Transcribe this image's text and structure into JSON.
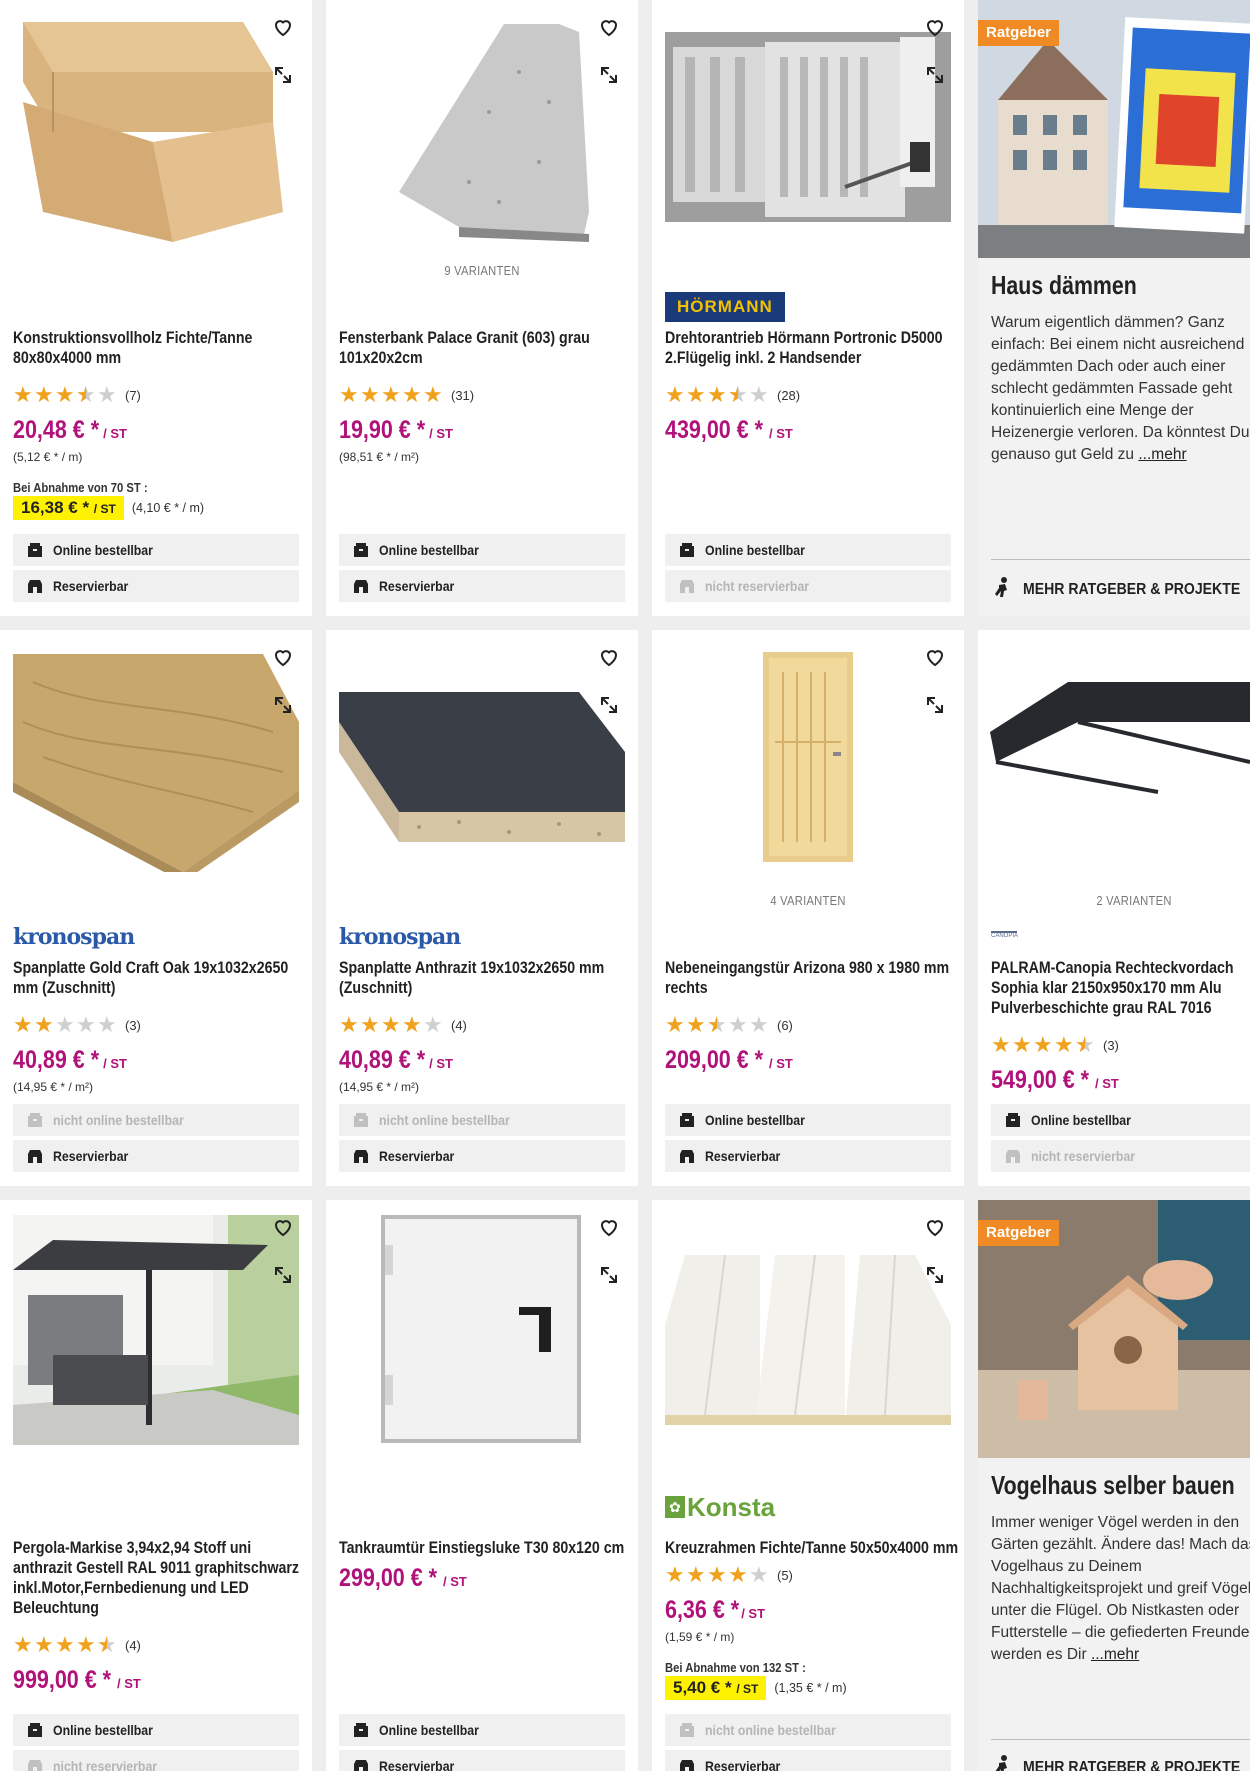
{
  "products": [
    {
      "title": "Konstruktionsvollholz Fichte/Tanne 80x80x4000 mm",
      "stars": [
        1,
        1,
        1,
        0.5,
        0
      ],
      "reviews": "(7)",
      "price": "20,48 € *",
      "unit": "/ ST",
      "unit_price": "(5,12 € * / m)",
      "bulk_label": "Bei Abnahme von 70 ST :",
      "bulk_price": "16,38 € *",
      "bulk_unit": "/ ST",
      "bulk_unit_price": "(4,10 € * / m)",
      "online": "Online bestellbar",
      "reserve": "Reservierbar"
    },
    {
      "title": "Fensterbank Palace Granit (603) grau 101x20x2cm",
      "variants": "9 VARIANTEN",
      "stars": [
        1,
        1,
        1,
        1,
        1
      ],
      "reviews": "(31)",
      "price": "19,90 € *",
      "unit": "/ ST",
      "unit_price": "(98,51 € * / m²)",
      "online": "Online bestellbar",
      "reserve": "Reservierbar"
    },
    {
      "title": "Drehtorantrieb Hörmann Portronic D5000 2.Flügelig inkl. 2 Handsender",
      "brand": "HÖRMANN",
      "stars": [
        1,
        1,
        1,
        0.5,
        0
      ],
      "reviews": "(28)",
      "price": "439,00 € *",
      "unit": "/ ST",
      "online": "Online bestellbar",
      "reserve": "nicht reservierbar"
    },
    {
      "title": "Spanplatte Gold Craft Oak 19x1032x2650 mm (Zuschnitt)",
      "brand": "kronospan",
      "stars": [
        1,
        1,
        0,
        0,
        0
      ],
      "reviews": "(3)",
      "price": "40,89 € *",
      "unit": "/ ST",
      "unit_price": "(14,95 € * / m²)",
      "online": "nicht online bestellbar",
      "reserve": "Reservierbar"
    },
    {
      "title": "Spanplatte Anthrazit 19x1032x2650 mm (Zuschnitt)",
      "brand": "kronospan",
      "stars": [
        1,
        1,
        1,
        1,
        0
      ],
      "reviews": "(4)",
      "price": "40,89 € *",
      "unit": "/ ST",
      "unit_price": "(14,95 € * / m²)",
      "online": "nicht online bestellbar",
      "reserve": "Reservierbar"
    },
    {
      "title": "Nebeneingangstür Arizona 980 x 1980 mm rechts",
      "variants": "4 VARIANTEN",
      "stars": [
        1,
        1,
        0.5,
        0,
        0
      ],
      "reviews": "(6)",
      "price": "209,00 € *",
      "unit": "/ ST",
      "online": "Online bestellbar",
      "reserve": "Reservierbar"
    },
    {
      "title": "PALRAM-Canopia Rechteckvordach Sophia klar 2150x950x170 mm Alu Pulverbeschichte grau RAL 7016",
      "variants": "2 VARIANTEN",
      "stars": [
        1,
        1,
        1,
        1,
        0.5
      ],
      "reviews": "(3)",
      "price": "549,00 € *",
      "unit": "/ ST",
      "online": "Online bestellbar",
      "reserve": "nicht reservierbar"
    },
    {
      "title": "Pergola-Markise 3,94x2,94 Stoff uni anthrazit Gestell RAL 9011 graphitschwarz inkl.Motor,Fernbedienung und LED Beleuchtung",
      "stars": [
        1,
        1,
        1,
        1,
        0.5
      ],
      "reviews": "(4)",
      "price": "999,00 € *",
      "unit": "/ ST",
      "online": "Online bestellbar",
      "reserve": "nicht reservierbar"
    },
    {
      "title": "Tankraumtür Einstiegsluke T30 80x120 cm",
      "price": "299,00 € *",
      "unit": "/ ST",
      "online": "Online bestellbar",
      "reserve": "Reservierbar"
    },
    {
      "title": "Kreuzrahmen Fichte/Tanne 50x50x4000 mm",
      "brand": "Konsta",
      "stars": [
        1,
        1,
        1,
        1,
        0
      ],
      "reviews": "(5)",
      "price": "6,36 € *",
      "unit": "/ ST",
      "unit_price": "(1,59 € * / m)",
      "bulk_label": "Bei Abnahme von 132 ST :",
      "bulk_price": "5,40 € *",
      "bulk_unit": "/ ST",
      "bulk_unit_price": "(1,35 € * / m)",
      "online": "nicht online bestellbar",
      "reserve": "Reservierbar"
    }
  ],
  "ratgeber": [
    {
      "tag": "Ratgeber",
      "title": "Haus dämmen",
      "text": "Warum eigentlich dämmen? Ganz einfach: Bei einem nicht ausreichend gedämmten Dach oder auch einer schlecht gedämmten Fassade geht kontinuierlich eine Menge der Heizenergie verloren. Da könntest Du genauso gut Geld zu",
      "more_link": "...mehr",
      "more_button": "MEHR RATGEBER & PROJEKTE"
    },
    {
      "tag": "Ratgeber",
      "title": "Vogelhaus selber bauen",
      "text": "Immer weniger Vögel werden in den Gärten gezählt. Ändere das! Mach das Vogelhaus zu Deinem Nachhaltigkeitsprojekt und greif Vögeln unter die Flügel. Ob Nistkasten oder Futterstelle – die gefiederten Freunde werden es Dir",
      "more_link": "...mehr",
      "more_button": "MEHR RATGEBER & PROJEKTE"
    }
  ],
  "colors": {
    "price": "#b0127a",
    "stars": "#f0a21d",
    "highlight": "#fff200",
    "ratgeber_tag": "#f08a24"
  }
}
